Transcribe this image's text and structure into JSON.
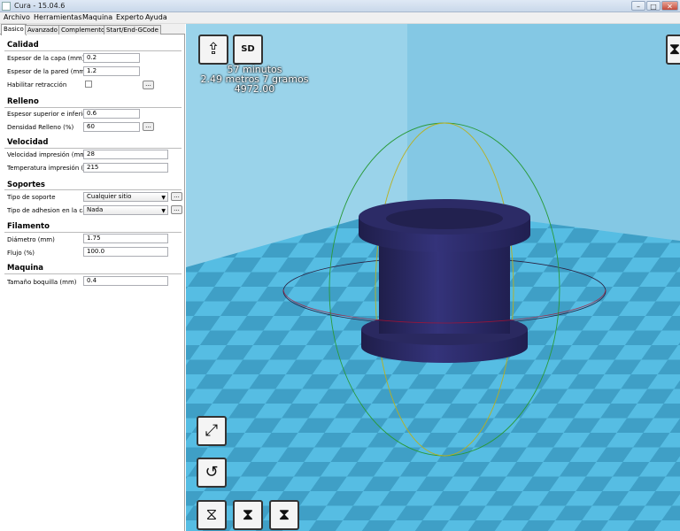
{
  "window": {
    "title": "Cura - 15.04.6"
  },
  "menu": [
    "Archivo",
    "Herramientas",
    "Maquina",
    "Experto",
    "Ayuda"
  ],
  "tabs": [
    "Basico",
    "Avanzado",
    "Complementos",
    "Start/End-GCode"
  ],
  "settings": {
    "calidad": {
      "title": "Calidad",
      "layer_height_label": "Espesor de la capa (mm)",
      "layer_height": "0.2",
      "wall_label": "Espesor de la pared (mm)",
      "wall": "1.2",
      "retraction_label": "Habilitar retracción"
    },
    "relleno": {
      "title": "Relleno",
      "topbottom_label": "Espesor superior e inferior",
      "topbottom": "0.6",
      "density_label": "Densidad Relleno (%)",
      "density": "60"
    },
    "velocidad": {
      "title": "Velocidad",
      "speed_label": "Velocidad impresión (mm/s)",
      "speed": "28",
      "temp_label": "Temperatura impresión (C)",
      "temp": "215"
    },
    "soportes": {
      "title": "Soportes",
      "support_label": "Tipo de soporte",
      "support": "Cualquier sitio",
      "adhesion_label": "Tipo de adhesion en la cama",
      "adhesion": "Nada"
    },
    "filamento": {
      "title": "Filamento",
      "diameter_label": "Diámetro (mm)",
      "diameter": "1.75",
      "flow_label": "Flujo (%)",
      "flow": "100.0"
    },
    "maquina": {
      "title": "Maquina",
      "nozzle_label": "Tamaño boquilla (mm)",
      "nozzle": "0.4"
    },
    "more_button": "..."
  },
  "stats": {
    "time": "57 minutos",
    "material": "2.49 metros 7 gramos",
    "cost": "4972.00"
  },
  "toolbar": {
    "load_icon": "load-icon",
    "save_label": "SD"
  },
  "colors": {
    "bed": "#4fb8e0",
    "wall": "#8fd0ec",
    "model": "#2b2a63"
  }
}
